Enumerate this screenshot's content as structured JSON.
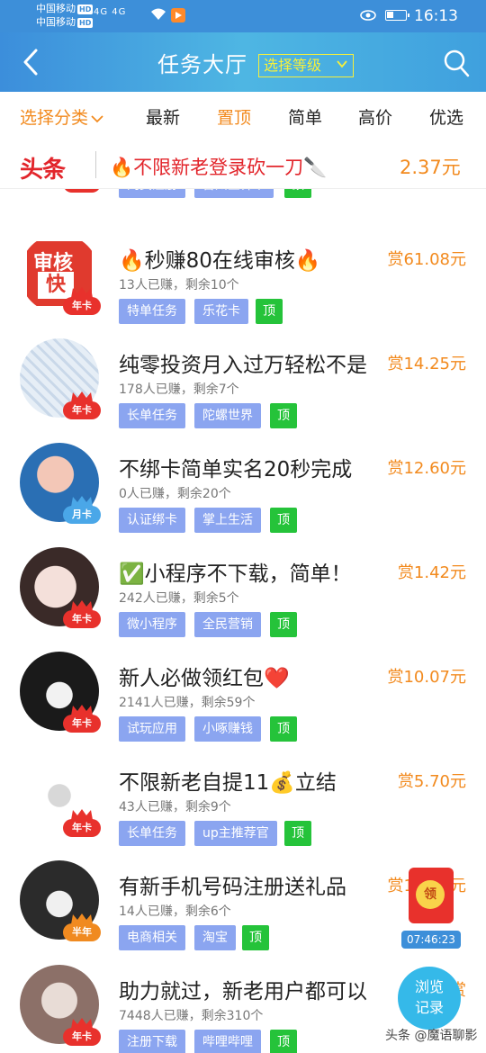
{
  "status": {
    "carrier1": "中国移动",
    "carrier2": "中国移动",
    "hd": "HD",
    "signal": "4G 4G",
    "time": "16:13"
  },
  "header": {
    "title": "任务大厅",
    "level_select": "选择等级"
  },
  "tabs": [
    {
      "label": "选择分类"
    },
    {
      "label": "最新"
    },
    {
      "label": "置顶"
    },
    {
      "label": "简单"
    },
    {
      "label": "高价"
    },
    {
      "label": "优选"
    }
  ],
  "banner": {
    "logo": "头条",
    "text": "🔥不限新老登录砍一刀🔪",
    "price": "2.37元"
  },
  "items": [
    {
      "title": "",
      "reward": "",
      "stats": "",
      "badge": "年卡",
      "tags": [
        "网页注册",
        "台州金钟罩",
        "顶"
      ]
    },
    {
      "title": "🔥秒赚80在线审核🔥",
      "reward": "赏61.08元",
      "stats": "13人已赚，剩余10个",
      "badge": "年卡",
      "avatar_text": [
        "审核",
        "快"
      ],
      "tags": [
        "特单任务",
        "乐花卡",
        "顶"
      ]
    },
    {
      "title": "纯零投资月入过万轻松不是",
      "reward": "赏14.25元",
      "stats": "178人已赚，剩余7个",
      "badge": "年卡",
      "tags": [
        "长单任务",
        "陀螺世界",
        "顶"
      ]
    },
    {
      "title": "不绑卡简单实名20秒完成",
      "reward": "赏12.60元",
      "stats": "0人已赚，剩余20个",
      "badge": "月卡",
      "tags": [
        "认证绑卡",
        "掌上生活",
        "顶"
      ]
    },
    {
      "title": "✅小程序不下载，简单！",
      "reward": "赏1.42元",
      "stats": "242人已赚，剩余5个",
      "badge": "年卡",
      "tags": [
        "微小程序",
        "全民营销",
        "顶"
      ]
    },
    {
      "title": "新人必做领红包❤️",
      "reward": "赏10.07元",
      "stats": "2141人已赚，剩余59个",
      "badge": "年卡",
      "tags": [
        "试玩应用",
        "小啄赚钱",
        "顶"
      ]
    },
    {
      "title": "不限新老自提11💰立结",
      "reward": "赏5.70元",
      "stats": "43人已赚，剩余9个",
      "badge": "年卡",
      "tags": [
        "长单任务",
        "up主推荐官",
        "顶"
      ]
    },
    {
      "title": "有新手机号码注册送礼品",
      "reward": "赏14.10元",
      "stats": "14人已赚，剩余6个",
      "badge": "半年",
      "tags": [
        "电商相关",
        "淘宝",
        "顶"
      ]
    },
    {
      "title": "助力就过，新老用户都可以",
      "reward": "赏",
      "stats": "7448人已赚，剩余310个",
      "badge": "年卡",
      "tags": [
        "注册下载",
        "哔哩哔哩",
        "顶"
      ]
    }
  ],
  "float": {
    "redpacket_label": "领",
    "timer": "07:46:23",
    "browse_line1": "浏览",
    "browse_line2": "记录"
  },
  "watermark": "头条 @魔语聊影",
  "colors": {
    "primary": "#3d8fd9",
    "accent": "#f28a1e",
    "tag": "#8ba5f0",
    "top_tag": "#25c33a",
    "brand_red": "#e2252b"
  }
}
